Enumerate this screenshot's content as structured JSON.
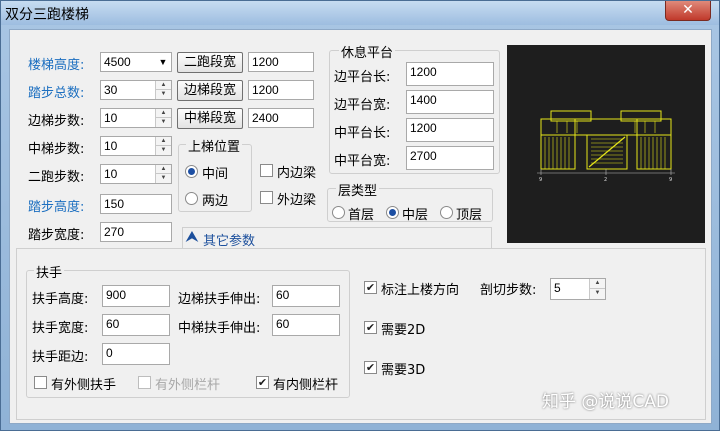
{
  "window": {
    "title": "双分三跑楼梯",
    "close_label": "✕"
  },
  "left_params": {
    "stair_height": {
      "label": "楼梯高度:",
      "value": "4500"
    },
    "step_total": {
      "label": "踏步总数:",
      "value": "30"
    },
    "side_steps": {
      "label": "边梯步数:",
      "value": "10"
    },
    "middle_steps": {
      "label": "中梯步数:",
      "value": "10"
    },
    "second_run_steps": {
      "label": "二跑步数:",
      "value": "10"
    },
    "step_height": {
      "label": "踏步高度:",
      "value": "150"
    },
    "step_width": {
      "label": "踏步宽度:",
      "value": "270"
    }
  },
  "width_buttons": {
    "second_run": {
      "label": "二跑段宽",
      "value": "1200"
    },
    "side_run": {
      "label": "边梯段宽",
      "value": "1200"
    },
    "middle_run": {
      "label": "中梯段宽",
      "value": "2400"
    }
  },
  "up_position": {
    "title": "上梯位置",
    "options": [
      "中间",
      "两边"
    ],
    "selected": "中间"
  },
  "beams": {
    "inner_label": "内边梁",
    "outer_label": "外边梁",
    "inner_checked": false,
    "outer_checked": false
  },
  "landing": {
    "title": "休息平台",
    "side_length": {
      "label": "边平台长:",
      "value": "1200"
    },
    "side_width": {
      "label": "边平台宽:",
      "value": "1400"
    },
    "middle_length": {
      "label": "中平台长:",
      "value": "1200"
    },
    "middle_width": {
      "label": "中平台宽:",
      "value": "2700"
    }
  },
  "floor_type": {
    "title": "层类型",
    "options": [
      "首层",
      "中层",
      "顶层"
    ],
    "selected": "中层"
  },
  "other_tab": {
    "label": "其它参数"
  },
  "handrail": {
    "title": "扶手",
    "height": {
      "label": "扶手高度:",
      "value": "900"
    },
    "width": {
      "label": "扶手宽度:",
      "value": "60"
    },
    "edge_distance": {
      "label": "扶手距边:",
      "value": "0"
    },
    "side_extend": {
      "label": "边梯扶手伸出:",
      "value": "60"
    },
    "middle_extend": {
      "label": "中梯扶手伸出:",
      "value": "60"
    },
    "outer_handrail": {
      "label": "有外侧扶手",
      "checked": false
    },
    "outer_railing": {
      "label": "有外侧栏杆",
      "checked": false,
      "disabled": true
    },
    "inner_railing": {
      "label": "有内侧栏杆",
      "checked": true
    }
  },
  "options": {
    "mark_up_direction": {
      "label": "标注上楼方向",
      "checked": true
    },
    "cut_steps": {
      "label": "剖切步数:",
      "value": "5"
    },
    "need_2d": {
      "label": "需要2D",
      "checked": true
    },
    "need_3d": {
      "label": "需要3D",
      "checked": true
    }
  },
  "preview_labels": [
    "9",
    "2",
    "9"
  ],
  "watermark": "知乎 @说说CAD",
  "colors": {
    "preview_bg": "#1e1e1e",
    "stair_yellow": "#e6e619",
    "accent_blue": "#1c6fc0"
  }
}
